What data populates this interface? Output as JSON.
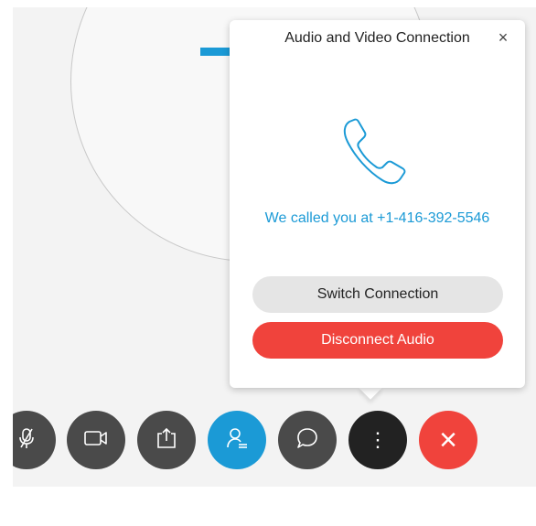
{
  "popup": {
    "title": "Audio and Video Connection",
    "close_symbol": "×",
    "icon": "phone-icon",
    "called_text": "We called you at +1-416-392-5546",
    "switch_label": "Switch Connection",
    "disconnect_label": "Disconnect Audio"
  },
  "toolbar": {
    "buttons": [
      {
        "name": "mute-button",
        "icon": "microphone-muted-icon"
      },
      {
        "name": "video-button",
        "icon": "video-camera-icon"
      },
      {
        "name": "share-button",
        "icon": "share-icon"
      },
      {
        "name": "participants-button",
        "icon": "participants-icon"
      },
      {
        "name": "chat-button",
        "icon": "chat-bubble-icon"
      },
      {
        "name": "more-button",
        "icon": "more-options-icon",
        "symbol": "⋮"
      },
      {
        "name": "leave-button",
        "icon": "close-icon",
        "symbol": "×"
      }
    ]
  },
  "colors": {
    "accent": "#1b9ad6",
    "danger": "#f0433c",
    "toolbar_dark": "#4a4a4a",
    "toolbar_black": "#222222"
  }
}
